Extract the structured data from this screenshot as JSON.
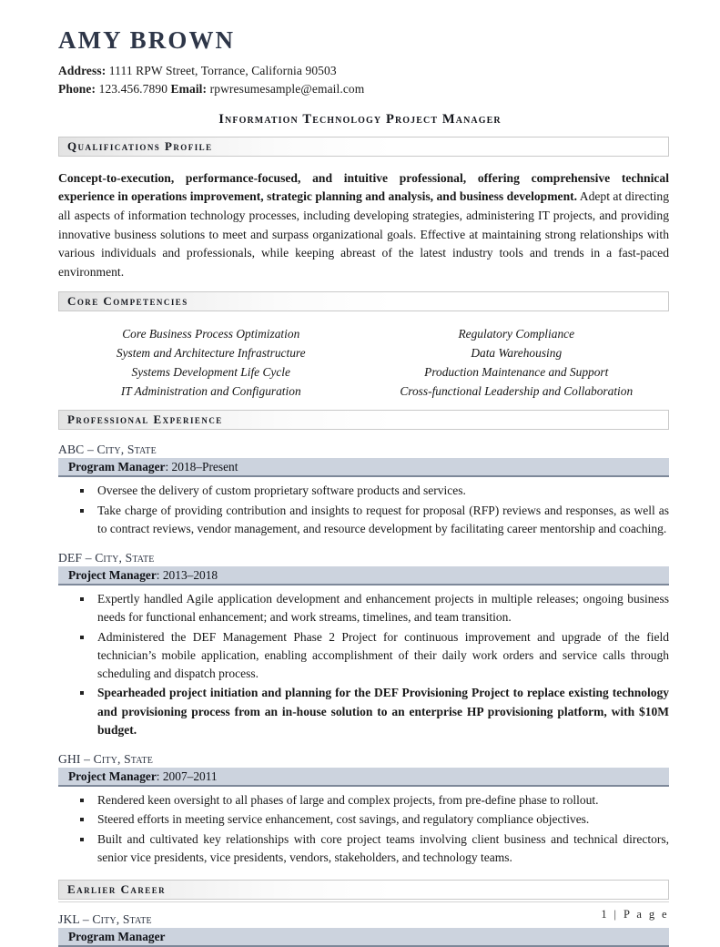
{
  "header": {
    "name": "AMY BROWN",
    "address_label": "Address:",
    "address_value": "1111 RPW Street, Torrance, California 90503",
    "phone_label": "Phone:",
    "phone_value": "123.456.7890",
    "email_label": "Email:",
    "email_value": "rpwresumesample@email.com",
    "headline": "Information Technology Project Manager"
  },
  "sections": {
    "qualifications_profile": "Qualifications Profile",
    "core_competencies": "Core Competencies",
    "professional_experience": "Professional Experience",
    "earlier_career": "Earlier Career"
  },
  "profile": {
    "bold_lead": "Concept-to-execution, performance-focused, and intuitive professional, offering comprehensive technical experience in operations improvement, strategic planning and analysis, and business development.",
    "rest": " Adept at directing all aspects of information technology processes, including developing strategies, administering IT projects, and providing innovative business solutions to meet and surpass organizational goals. Effective at maintaining strong relationships with various individuals and professionals, while keeping abreast of the latest industry tools and trends in a fast-paced environment."
  },
  "competencies": {
    "left": [
      "Core Business Process Optimization",
      "System and Architecture Infrastructure",
      "Systems Development Life Cycle",
      "IT Administration and Configuration"
    ],
    "right": [
      "Regulatory Compliance",
      "Data Warehousing",
      "Production Maintenance and Support",
      "Cross-functional Leadership and Collaboration"
    ]
  },
  "experience": [
    {
      "company": "ABC",
      "separator": " – ",
      "location": "City, State",
      "title": "Program Manager",
      "dates": ": 2018–Present",
      "bullets": [
        {
          "text": "Oversee the delivery of custom proprietary software products and services.",
          "bold": false
        },
        {
          "text": "Take charge of providing contribution and insights to request for proposal (RFP) reviews and responses, as well as to contract reviews, vendor management, and resource development by facilitating career mentorship and coaching.",
          "bold": false
        }
      ]
    },
    {
      "company": "DEF",
      "separator": " – ",
      "location": "City, State",
      "title": "Project Manager",
      "dates": ": 2013–2018",
      "bullets": [
        {
          "text": "Expertly handled Agile application development and enhancement projects in multiple releases; ongoing business needs for functional enhancement; and work streams, timelines, and team transition.",
          "bold": false
        },
        {
          "text": "Administered the DEF Management Phase 2 Project for continuous improvement and upgrade of the field technician’s mobile application, enabling accomplishment of their daily work orders and service calls through scheduling and dispatch process.",
          "bold": false
        },
        {
          "text": "Spearheaded project initiation and planning for the DEF Provisioning Project to replace existing technology and provisioning process from an in-house solution to an enterprise HP provisioning platform, with $10M budget.",
          "bold": true
        }
      ]
    },
    {
      "company": "GHI",
      "separator": " – ",
      "location": "City, State",
      "title": "Project Manager",
      "dates": ": 2007–2011",
      "bullets": [
        {
          "text": "Rendered keen oversight to all phases of large and complex projects, from pre-define phase to rollout.",
          "bold": false
        },
        {
          "text": "Steered efforts in meeting service enhancement, cost savings, and regulatory compliance objectives.",
          "bold": false
        },
        {
          "text": "Built and cultivated key relationships with core project teams involving client business and technical directors, senior vice presidents, vice presidents, vendors, stakeholders, and technology teams.",
          "bold": false
        }
      ]
    }
  ],
  "earlier_career": [
    {
      "company": "JKL",
      "separator": " – ",
      "location": "City, State",
      "title": "Program Manager",
      "dates": ""
    }
  ],
  "footer": {
    "page": "1  |  P a g e"
  }
}
